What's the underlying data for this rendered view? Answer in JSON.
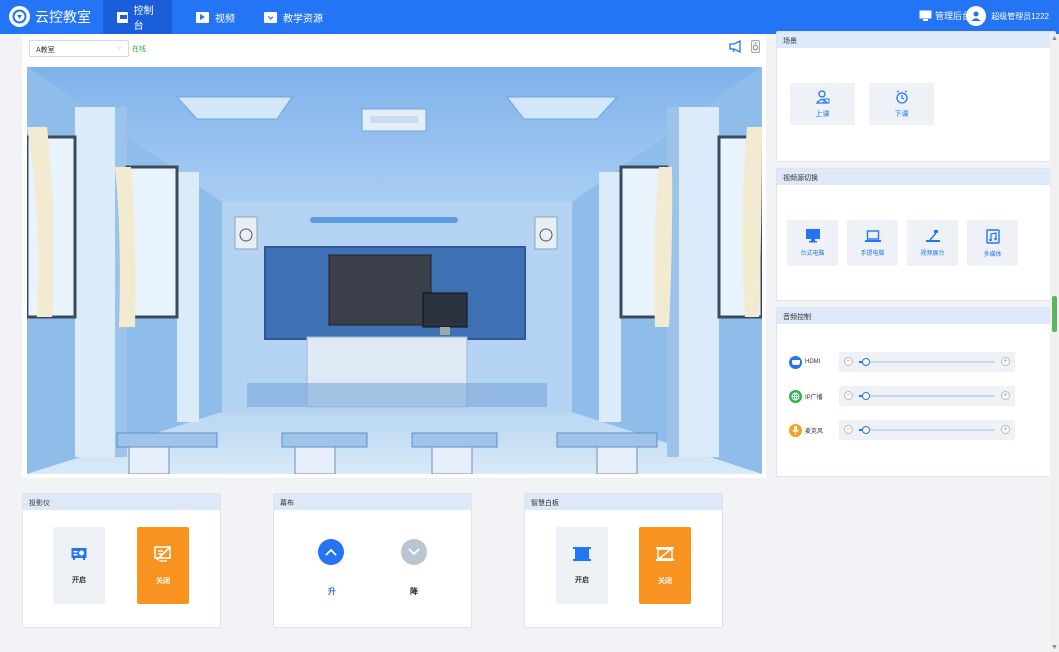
{
  "app": {
    "title": "云控教室"
  },
  "nav": [
    {
      "label": "控制台",
      "active": true
    },
    {
      "label": "视频",
      "active": false
    },
    {
      "label": "教学资源",
      "active": false
    }
  ],
  "header": {
    "admin_label": "管理后台",
    "user_name": "超级管理员1222"
  },
  "classroom": {
    "selected": "A教室",
    "status": "在线"
  },
  "projector": {
    "title": "投影仪",
    "on_label": "开启",
    "off_label": "关闭"
  },
  "screen": {
    "title": "幕布",
    "up_label": "升",
    "down_label": "降"
  },
  "whiteboard": {
    "title": "智慧白板",
    "on_label": "开启",
    "off_label": "关闭"
  },
  "scene": {
    "title": "场景",
    "items": [
      {
        "label": "上课",
        "icon": "class-icon"
      },
      {
        "label": "下课",
        "icon": "alarm-clock-icon"
      }
    ]
  },
  "video_source": {
    "title": "视频源切换",
    "items": [
      {
        "label": "台式电脑",
        "icon": "desktop-icon"
      },
      {
        "label": "手提电脑",
        "icon": "laptop-icon"
      },
      {
        "label": "视频展台",
        "icon": "visualizer-icon"
      },
      {
        "label": "多媒体",
        "icon": "multimedia-icon"
      }
    ]
  },
  "audio": {
    "title": "音频控制",
    "channels": [
      {
        "label": "HDMI",
        "color": "#2474f6",
        "level": 0.05
      },
      {
        "label": "IP广播",
        "color": "#28b34b",
        "level": 0.05
      },
      {
        "label": "麦克风",
        "color": "#f7a11e",
        "level": 0.05
      }
    ]
  },
  "colors": {
    "primary": "#2474f6",
    "accent_orange": "#f7931e",
    "online": "#28b34b"
  }
}
